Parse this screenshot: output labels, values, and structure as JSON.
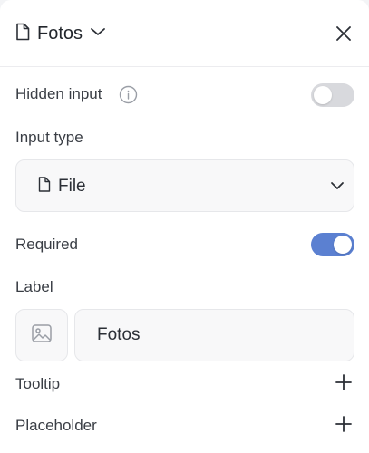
{
  "header": {
    "title": "Fotos",
    "icons": {
      "title": "file-icon",
      "dropdown": "chevron-down-icon",
      "close": "close-icon"
    }
  },
  "hidden_input": {
    "label": "Hidden input",
    "info_icon": "info-icon",
    "enabled": false
  },
  "input_type": {
    "label": "Input type",
    "selected": "File",
    "icon": "file-icon"
  },
  "required": {
    "label": "Required",
    "enabled": true
  },
  "label_section": {
    "label": "Label",
    "value": "Fotos",
    "image_icon": "image-icon"
  },
  "tooltip": {
    "label": "Tooltip",
    "icon": "plus-icon"
  },
  "placeholder": {
    "label": "Placeholder",
    "icon": "plus-icon"
  },
  "colors": {
    "toggle_on": "#5b80d1",
    "toggle_off": "#d8d9dd",
    "icon": "#2b2f36",
    "muted_icon": "#9a9ea6"
  }
}
